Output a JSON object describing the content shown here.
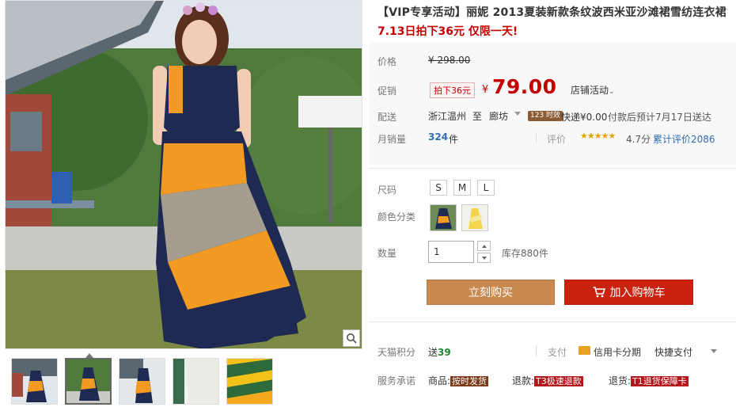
{
  "product": {
    "title": "【VIP专享活动】丽妮 2013夏装新款条纹波西米亚沙滩裙雪纺连衣裙",
    "promo_line": "7.13日拍下36元 仅限一天!"
  },
  "price": {
    "label": "价格",
    "original": "¥ 298.00",
    "promo_label": "促销",
    "promo_tag": "拍下36元",
    "currency": "¥",
    "sale": "79.00",
    "shop_activity": "店铺活动"
  },
  "shipping": {
    "label": "配送",
    "from": "浙江温州",
    "to_word": "至",
    "to_city": "廊坊",
    "badge": "123 时效",
    "express": "快递¥0.00",
    "note": "付款后预计7月17日送达"
  },
  "sales": {
    "label": "月销量",
    "count": "324",
    "unit": "件",
    "rating_label": "评价",
    "stars": "★★★★★",
    "score": "4.7分",
    "reviews": "累计评价2086"
  },
  "options": {
    "size_label": "尺码",
    "sizes": [
      "S",
      "M",
      "L"
    ],
    "color_label": "颜色分类",
    "qty_label": "数量",
    "qty_value": "1",
    "stock": "库存880件"
  },
  "actions": {
    "buy_now": "立刻购买",
    "add_cart": "加入购物车"
  },
  "points": {
    "label": "天猫积分",
    "prefix": "送",
    "value": "39",
    "pay_label": "支付",
    "pay_card": "信用卡分期",
    "pay_quick": "快捷支付"
  },
  "service": {
    "label": "服务承诺",
    "item1_prefix": "商品:",
    "item1_tag": "按时发货",
    "item2_prefix": "退款:",
    "item2_tag": "T3极速退款",
    "item3_prefix": "退货:",
    "item3_tag": "T1退货保障卡"
  },
  "colors": {
    "price_red": "#c40000",
    "buy_button": "#c9894f",
    "cart_button": "#c9230f",
    "link_blue": "#2e6eb3"
  }
}
